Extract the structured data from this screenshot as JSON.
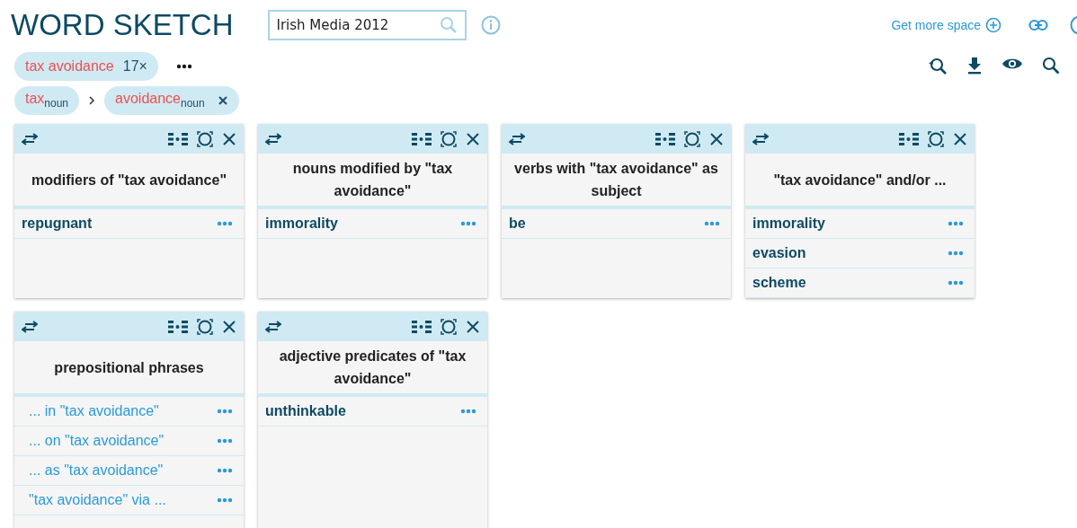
{
  "app_title": "WORD SKETCH",
  "corpus_search": {
    "value": "Irish Media 2012"
  },
  "top_link": {
    "label": "Get more space"
  },
  "query_chip": {
    "label": "tax avoidance",
    "count": "17×"
  },
  "breadcrumb": [
    {
      "word": "tax",
      "pos": "noun",
      "removable": false
    },
    {
      "word": "avoidance",
      "pos": "noun",
      "removable": true
    }
  ],
  "panels": [
    {
      "title": "modifiers of \"tax avoidance\"",
      "items": [
        {
          "kind": "word",
          "text": "repugnant"
        }
      ]
    },
    {
      "title": "nouns modified by \"tax avoidance\"",
      "items": [
        {
          "kind": "word",
          "text": "immorality"
        }
      ]
    },
    {
      "title": "verbs with \"tax avoidance\" as subject",
      "items": [
        {
          "kind": "word",
          "text": "be"
        }
      ]
    },
    {
      "title": "\"tax avoidance\" and/or ...",
      "items": [
        {
          "kind": "word",
          "text": "immorality"
        },
        {
          "kind": "word",
          "text": "evasion"
        },
        {
          "kind": "word",
          "text": "scheme"
        }
      ]
    },
    {
      "title": "prepositional phrases",
      "items": [
        {
          "kind": "phrase",
          "text": "... in \"tax avoidance\""
        },
        {
          "kind": "phrase",
          "text": "... on \"tax avoidance\""
        },
        {
          "kind": "phrase",
          "text": "... as \"tax avoidance\""
        },
        {
          "kind": "phrase",
          "text": "\"tax avoidance\" via ..."
        }
      ]
    },
    {
      "title": "adjective predicates of \"tax avoidance\"",
      "items": [
        {
          "kind": "word",
          "text": "unthinkable"
        }
      ]
    }
  ]
}
